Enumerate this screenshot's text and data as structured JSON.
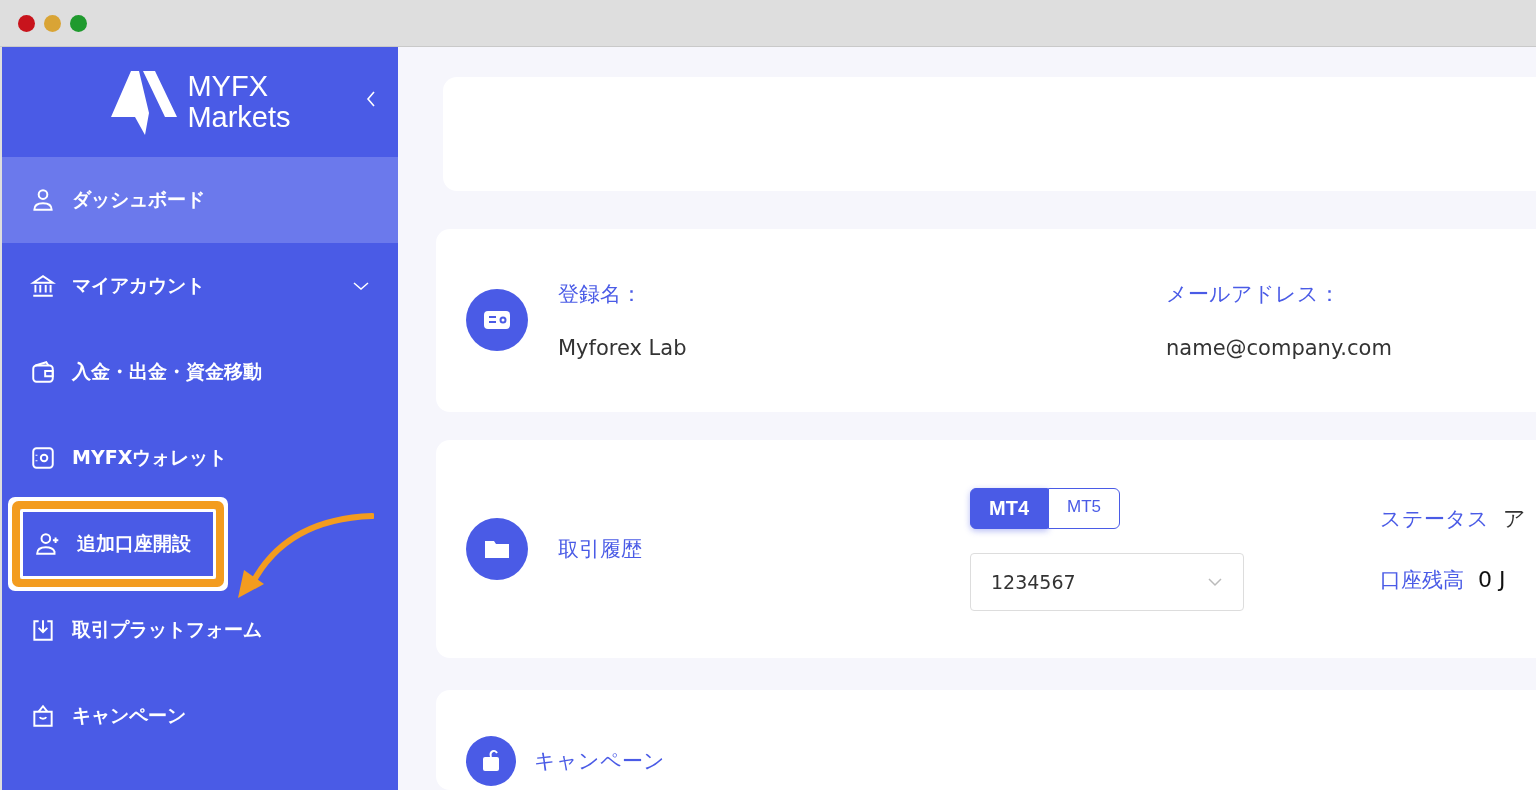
{
  "brand": {
    "line1": "MYFX",
    "line2": "Markets"
  },
  "sidebar": {
    "items": [
      {
        "label": "ダッシュボード",
        "kind": "link",
        "selected": true,
        "annotated": false
      },
      {
        "label": "マイアカウント",
        "kind": "group",
        "selected": false,
        "annotated": false
      },
      {
        "label": "入金・出金・資金移動",
        "kind": "link",
        "selected": false,
        "annotated": false
      },
      {
        "label": "MYFXウォレット",
        "kind": "link",
        "selected": false,
        "annotated": false
      },
      {
        "label": "追加口座開設",
        "kind": "link",
        "selected": false,
        "annotated": true
      },
      {
        "label": "取引プラットフォーム",
        "kind": "link",
        "selected": false,
        "annotated": false
      },
      {
        "label": "キャンペーン",
        "kind": "link",
        "selected": false,
        "annotated": false
      }
    ]
  },
  "profile": {
    "name_label": "登録名：",
    "name": "Myforex Lab",
    "email_label": "メールアドレス：",
    "email": "name@company.com"
  },
  "history": {
    "title": "取引履歴",
    "tabs": [
      {
        "label": "MT4",
        "selected": true
      },
      {
        "label": "MT5",
        "selected": false
      }
    ],
    "account": "1234567",
    "status_label": "ステータス",
    "status": "ア",
    "balance_label": "口座残高",
    "balance": "0 J"
  },
  "campaign": {
    "title": "キャンペーン"
  }
}
